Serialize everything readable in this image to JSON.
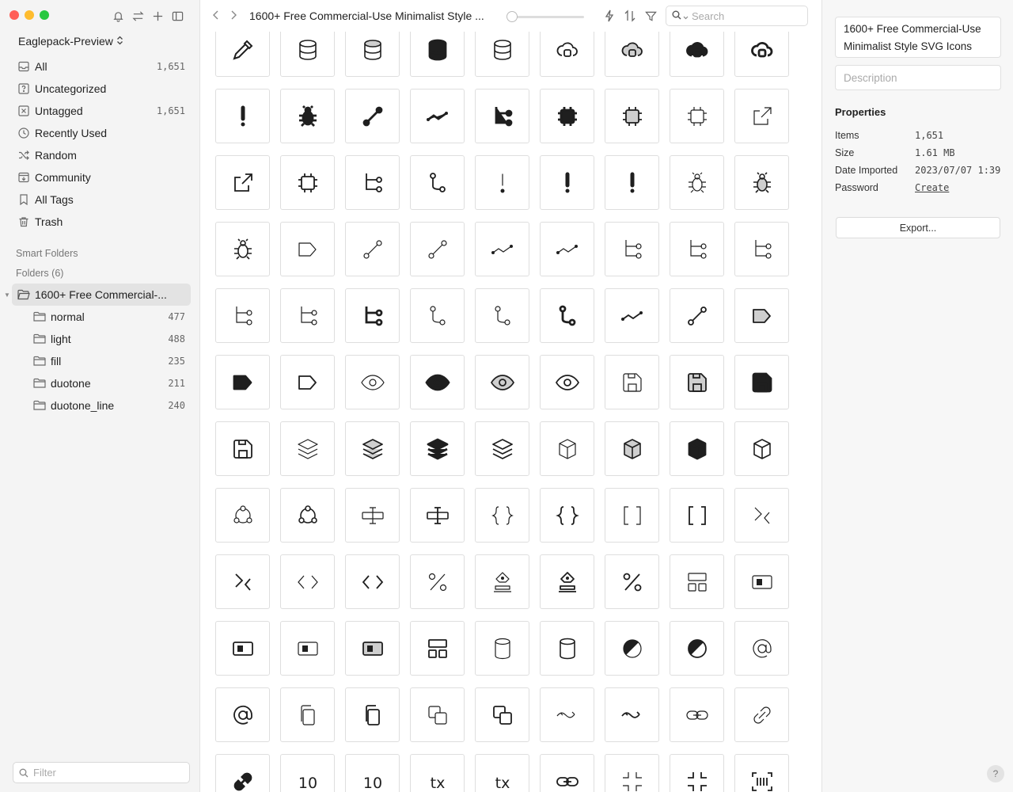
{
  "window": {
    "traffic_colors": [
      "#ff5f57",
      "#febc2e",
      "#28c840"
    ]
  },
  "sidebar": {
    "library_name": "Eaglepack-Preview",
    "library_chevron": "⌃⌄",
    "items": [
      {
        "label": "All",
        "count": "1,651",
        "icon": "inbox-icon"
      },
      {
        "label": "Uncategorized",
        "count": "",
        "icon": "question-box-icon"
      },
      {
        "label": "Untagged",
        "count": "1,651",
        "icon": "untagged-icon"
      },
      {
        "label": "Recently Used",
        "count": "",
        "icon": "clock-icon"
      },
      {
        "label": "Random",
        "count": "",
        "icon": "shuffle-icon"
      },
      {
        "label": "Community",
        "count": "",
        "icon": "community-icon"
      },
      {
        "label": "All Tags",
        "count": "",
        "icon": "tag-icon"
      },
      {
        "label": "Trash",
        "count": "",
        "icon": "trash-icon"
      }
    ],
    "smart_folders_label": "Smart Folders",
    "folders_label": "Folders (6)",
    "root_folder": "1600+ Free Commercial-...",
    "subfolders": [
      {
        "label": "normal",
        "count": "477"
      },
      {
        "label": "light",
        "count": "488"
      },
      {
        "label": "fill",
        "count": "235"
      },
      {
        "label": "duotone",
        "count": "211"
      },
      {
        "label": "duotone_line",
        "count": "240"
      }
    ],
    "filter_placeholder": "Filter"
  },
  "toolbar": {
    "title": "1600+ Free Commercial-Use Minimalist Style ...",
    "search_placeholder": "Search"
  },
  "grid": {
    "icons": [
      "eyedropper",
      "database",
      "database-duotone",
      "database-fill",
      "database-line",
      "cloud-lock",
      "cloud-lock-duotone",
      "cloud-lock-fill",
      "cloud-lock-bold",
      "exclamation",
      "bug-fill",
      "line-segment-fill",
      "trend-fill",
      "tree-fill",
      "chip-fill",
      "chip-duotone",
      "chip-light",
      "external-link-light",
      "external-link",
      "chip",
      "tree",
      "branch",
      "exclamation-light",
      "exclamation-duotone",
      "exclamation-line",
      "bug-light",
      "bug-duotone",
      "bug",
      "tag-light",
      "line-segment-light",
      "line-segment-light2",
      "trend-light",
      "trend-light2",
      "tree-light",
      "tree-light2",
      "tree-light3",
      "tree-light4",
      "tree-light5",
      "tree-bold",
      "branch-light",
      "branch-light2",
      "branch-bold",
      "trend",
      "line-segment",
      "tag-duotone",
      "tag-fill",
      "tag",
      "eye-light",
      "eye-fill",
      "eye-duotone",
      "eye",
      "save-light",
      "save-duotone",
      "save-fill",
      "save",
      "layers-light",
      "layers-duotone",
      "layers-fill",
      "layers",
      "cube-light",
      "cube-duotone",
      "cube-fill",
      "cube",
      "tri-circles-light",
      "tri-circles",
      "text-cursor-light",
      "text-cursor",
      "braces-light",
      "braces",
      "brackets-light",
      "brackets",
      "mask-light",
      "mask",
      "code-light",
      "code",
      "percent-light",
      "stamp-light",
      "stamp",
      "percent",
      "layout-light",
      "slot-light",
      "slot",
      "slot-light2",
      "slot-duotone",
      "layout",
      "cylinder-light",
      "cylinder",
      "contrast-light",
      "contrast",
      "at-light",
      "at",
      "copy-light",
      "copy",
      "overlap-light",
      "overlap",
      "unlink-light",
      "unlink",
      "link-light",
      "link-diagonal-light",
      "link-diagonal-fill",
      "ten-light",
      "ten-duotone",
      "text-x-light",
      "text-x",
      "link",
      "collapse-light",
      "collapse",
      "scan"
    ]
  },
  "inspector": {
    "name_line1": "1600+ Free Commercial-Use",
    "name_line2": "Minimalist Style SVG Icons",
    "description_placeholder": "Description",
    "properties_heading": "Properties",
    "properties": [
      {
        "key": "Items",
        "value": "1,651"
      },
      {
        "key": "Size",
        "value": "1.61 MB"
      },
      {
        "key": "Date Imported",
        "value": "2023/07/07 1:39"
      },
      {
        "key": "Password",
        "value": "Create"
      }
    ],
    "export_label": "Export...",
    "help_label": "?"
  }
}
